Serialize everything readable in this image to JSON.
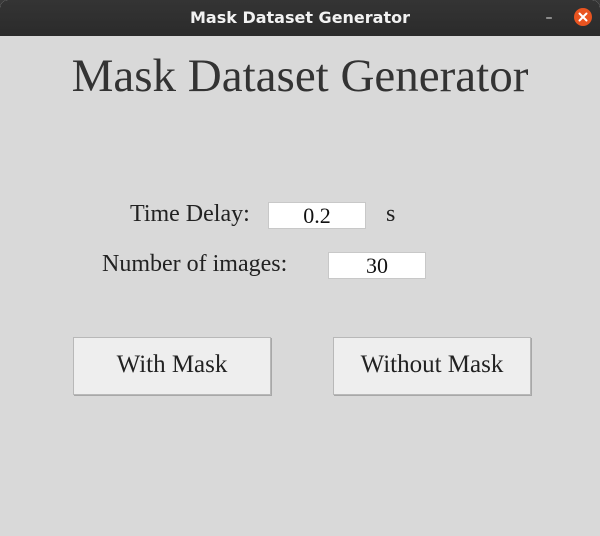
{
  "window": {
    "title": "Mask Dataset Generator",
    "minimize_glyph": "–",
    "close_icon": "close-icon",
    "accent_color": "#e95420"
  },
  "main": {
    "heading": "Mask Dataset Generator",
    "time_delay": {
      "label": "Time Delay:",
      "value": "0.2",
      "unit": "s"
    },
    "num_images": {
      "label": "Number of images:",
      "value": "30"
    },
    "buttons": {
      "with_mask": "With Mask",
      "without_mask": "Without Mask"
    }
  }
}
